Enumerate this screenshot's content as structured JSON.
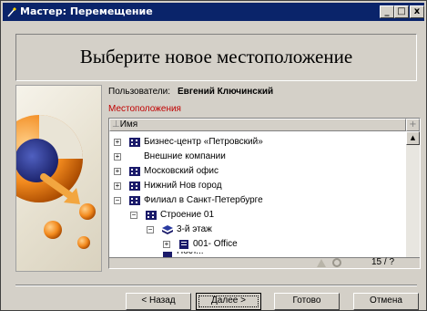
{
  "window": {
    "title": "Мастер: Перемещение",
    "controls": {
      "minimize": "_",
      "maximize": "□",
      "close": "x"
    }
  },
  "header": {
    "title": "Выберите новое местоположение"
  },
  "user": {
    "label": "Пользователи:",
    "value": "Евгений Ключинский"
  },
  "locations": {
    "label": "Местоположения",
    "label_color": "#c00000",
    "column_header": "Имя",
    "sort_glyph": "⊥",
    "add_column_glyph": "+",
    "rows": [
      {
        "label": "Бизнес-центр «Петровский»",
        "expander": "+",
        "icon": "building-icon"
      },
      {
        "label": "Внешние компании",
        "expander": "+",
        "icon": "none"
      },
      {
        "label": "Московский офис",
        "expander": "+",
        "icon": "building-icon"
      },
      {
        "label": "Нижний Нов город",
        "expander": "+",
        "icon": "building-icon"
      },
      {
        "label": "Филиал в Санкт-Петербурге",
        "expander": "−",
        "icon": "building-icon"
      },
      {
        "label": "Строение 01",
        "expander": "−",
        "icon": "building-icon"
      },
      {
        "label": "3-й этаж",
        "expander": "−",
        "icon": "stack-icon"
      },
      {
        "label": "001- Office",
        "expander": "+",
        "icon": "room-icon"
      },
      {
        "label": "Ност...",
        "expander": "",
        "icon": "room-icon"
      }
    ],
    "status": {
      "counter": "15 / ?"
    }
  },
  "buttons": {
    "back": "< Назад",
    "next": "Далее >",
    "finish": "Готово",
    "cancel": "Отмена"
  }
}
